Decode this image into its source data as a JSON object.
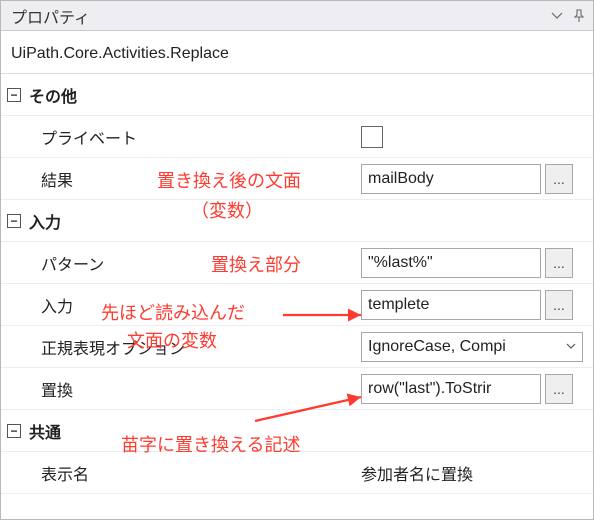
{
  "panel": {
    "title": "プロパティ",
    "type": "UiPath.Core.Activities.Replace"
  },
  "groups": {
    "misc": "その他",
    "input": "入力",
    "common": "共通"
  },
  "props": {
    "private": {
      "label": "プライベート"
    },
    "result": {
      "label": "結果",
      "value": "mailBody"
    },
    "pattern": {
      "label": "パターン",
      "value": "\"%last%\""
    },
    "inputVal": {
      "label": "入力",
      "value": "templete"
    },
    "regexOption": {
      "label": "正規表現オプション",
      "value": "IgnoreCase, Compi"
    },
    "replace": {
      "label": "置換",
      "value": "row(\"last\").ToStrir"
    },
    "displayName": {
      "label": "表示名",
      "value": "参加者名に置換"
    }
  },
  "annotations": {
    "a1l1": "置き換え後の文面",
    "a1l2": "（変数）",
    "a2": "置換え部分",
    "a3l1": "先ほど読み込んだ",
    "a3l2": "文面の変数",
    "a4": "苗字に置き換える記述"
  },
  "ui": {
    "ellipsis": "...",
    "minus": "−",
    "chevron": "⌄",
    "dropdown_chev": "⌄"
  }
}
